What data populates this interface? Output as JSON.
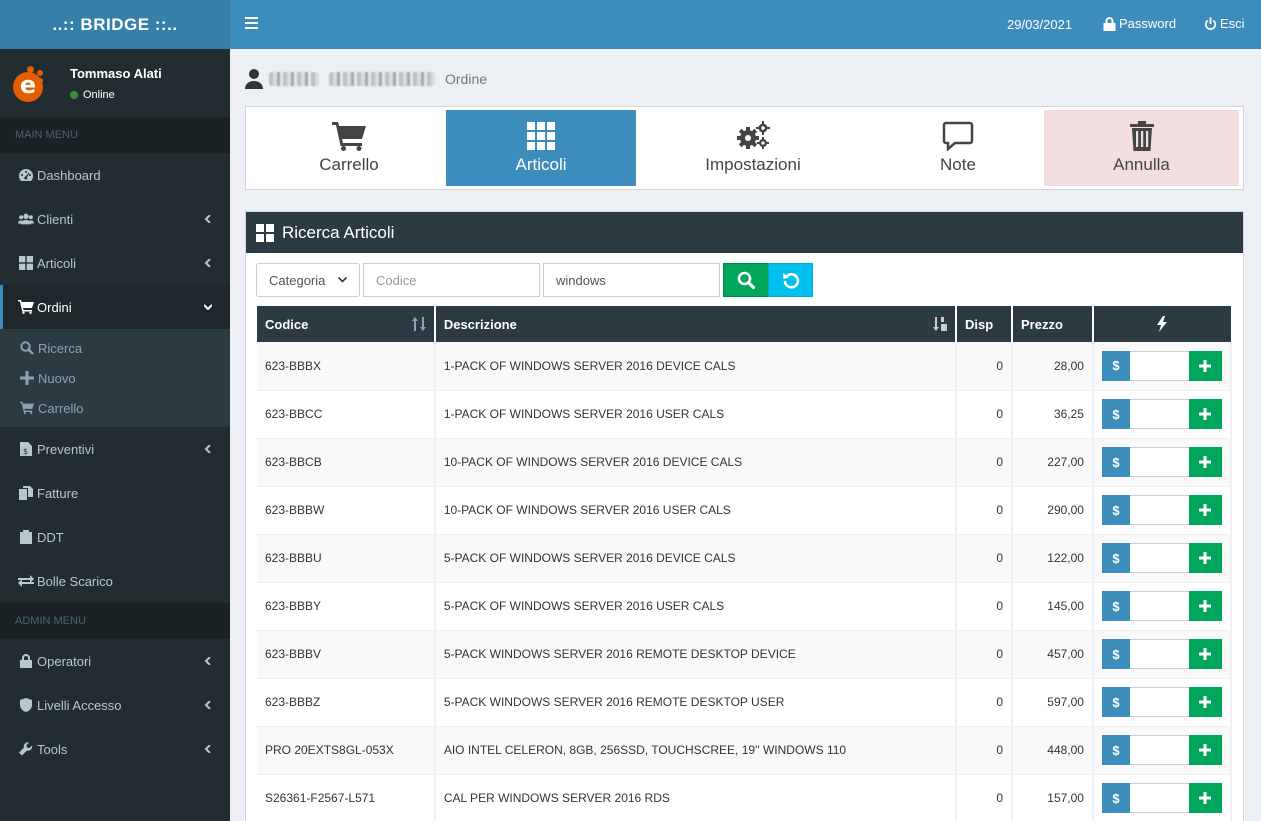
{
  "app": {
    "logo": "..:: BRIDGE ::.."
  },
  "user": {
    "name": "Tommaso Alati",
    "status": "Online"
  },
  "menu": {
    "main_header": "MAIN MENU",
    "admin_header": "ADMIN MENU",
    "items": [
      {
        "label": "Dashboard"
      },
      {
        "label": "Clienti"
      },
      {
        "label": "Articoli"
      },
      {
        "label": "Ordini"
      },
      {
        "label": "Preventivi"
      },
      {
        "label": "Fatture"
      },
      {
        "label": "DDT"
      },
      {
        "label": "Bolle Scarico"
      }
    ],
    "sub_items": [
      {
        "label": "Ricerca"
      },
      {
        "label": "Nuovo"
      },
      {
        "label": "Carrello"
      }
    ],
    "admin_items": [
      {
        "label": "Operatori"
      },
      {
        "label": "Livelli Accesso"
      },
      {
        "label": "Tools"
      }
    ]
  },
  "topbar": {
    "date": "29/03/2021",
    "password": "Password",
    "logout": "Esci"
  },
  "header": {
    "subtitle": "Ordine"
  },
  "tabs": [
    {
      "label": "Carrello",
      "icon": "cart-icon"
    },
    {
      "label": "Articoli",
      "icon": "grid-icon"
    },
    {
      "label": "Impostazioni",
      "icon": "gears-icon"
    },
    {
      "label": "Note",
      "icon": "comment-icon"
    },
    {
      "label": "Annulla",
      "icon": "trash-icon"
    }
  ],
  "panel": {
    "title": "Ricerca Articoli",
    "category_select": "Categoria",
    "code_placeholder": "Codice",
    "description_value": "windows"
  },
  "table": {
    "headers": {
      "code": "Codice",
      "description": "Descrizione",
      "disp": "Disp",
      "price": "Prezzo"
    },
    "rows": [
      {
        "code": "623-BBBX",
        "description": "1-PACK OF WINDOWS SERVER 2016 DEVICE CALS",
        "disp": "0",
        "price": "28,00"
      },
      {
        "code": "623-BBCC",
        "description": "1-PACK OF WINDOWS SERVER 2016 USER CALS",
        "disp": "0",
        "price": "36,25"
      },
      {
        "code": "623-BBCB",
        "description": "10-PACK OF WINDOWS SERVER 2016 DEVICE CALS",
        "disp": "0",
        "price": "227,00"
      },
      {
        "code": "623-BBBW",
        "description": "10-PACK OF WINDOWS SERVER 2016 USER CALS",
        "disp": "0",
        "price": "290,00"
      },
      {
        "code": "623-BBBU",
        "description": "5-PACK OF WINDOWS SERVER 2016 DEVICE CALS",
        "disp": "0",
        "price": "122,00"
      },
      {
        "code": "623-BBBY",
        "description": "5-PACK OF WINDOWS SERVER 2016 USER CALS",
        "disp": "0",
        "price": "145,00"
      },
      {
        "code": "623-BBBV",
        "description": "5-PACK WINDOWS SERVER 2016 REMOTE DESKTOP DEVICE",
        "disp": "0",
        "price": "457,00"
      },
      {
        "code": "623-BBBZ",
        "description": "5-PACK WINDOWS SERVER 2016 REMOTE DESKTOP USER",
        "disp": "0",
        "price": "597,00"
      },
      {
        "code": "PRO 20EXTS8GL-053X",
        "description": "AIO INTEL CELERON, 8GB, 256SSD, TOUCHSCREE, 19'' WINDOWS 110",
        "disp": "0",
        "price": "448,00"
      },
      {
        "code": "S26361-F2567-L571",
        "description": "CAL PER WINDOWS SERVER 2016 RDS",
        "disp": "0",
        "price": "157,00"
      }
    ],
    "action_price_label": "$"
  },
  "colors": {
    "primary": "#3c8dbc",
    "sidebar": "#222d32",
    "success": "#00a65a",
    "info": "#00c0ef",
    "danger_bg": "#f2dede"
  }
}
